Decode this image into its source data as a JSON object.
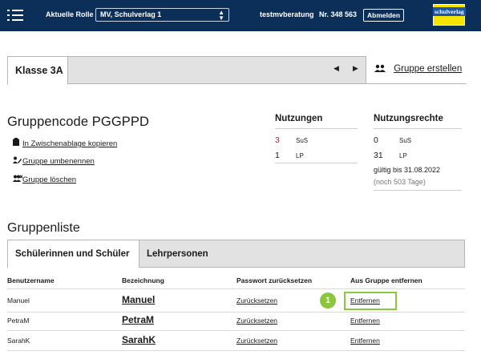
{
  "topbar": {
    "role_label": "Aktuelle Rolle",
    "role_value": "MV, Schulverlag 1",
    "user_name": "testmvberatung",
    "user_nr": "Nr. 348 563",
    "logout_label": "Abmelden",
    "logo_text": "schulverlag",
    "colors": {
      "bar": "#0c2f5a",
      "logo_bg": "#f5e400",
      "logo_text_bg": "#1b56a8"
    }
  },
  "class_tabs": {
    "active_tab": "Klasse 3A",
    "nav_prev_icon": "caret-left-icon",
    "nav_next_icon": "caret-right-icon",
    "create_group_label": "Gruppe erstellen",
    "create_group_icon": "users-icon"
  },
  "group": {
    "code_title": "Gruppencode PGGPPD",
    "actions": [
      {
        "icon": "clipboard-icon",
        "label": "In Zwischenablage kopieren"
      },
      {
        "icon": "users-edit-icon",
        "label": "Gruppe umbenennen"
      },
      {
        "icon": "users-delete-icon",
        "label": "Gruppe löschen"
      }
    ]
  },
  "usage": {
    "title": "Nutzungen",
    "rows": [
      {
        "value": "3",
        "unit": "SuS",
        "color": "#d21d1d"
      },
      {
        "value": "1",
        "unit": "LP",
        "color": "#1a1a1a"
      }
    ]
  },
  "rights": {
    "title": "Nutzungsrechte",
    "rows": [
      {
        "value": "0",
        "unit": "SuS"
      },
      {
        "value": "31",
        "unit": "LP"
      }
    ],
    "valid_until": "gültig bis 31.08.2022",
    "remaining": "(noch 503 Tage)"
  },
  "group_list": {
    "title": "Gruppenliste",
    "tabs": [
      {
        "label": "Schülerinnen und Schüler",
        "active": true
      },
      {
        "label": "Lehrpersonen",
        "active": false
      }
    ],
    "columns": [
      "Benutzername",
      "Bezeichnung",
      "Passwort zurücksetzen",
      "Aus Gruppe entfernen"
    ],
    "rows": [
      {
        "username": "Manuel",
        "name": "Manuel",
        "reset": "Zurücksetzen",
        "remove": "Entfernen"
      },
      {
        "username": "PetraM",
        "name": "PetraM",
        "reset": "Zurücksetzen",
        "remove": "Entfernen"
      },
      {
        "username": "SarahK",
        "name": "SarahK",
        "reset": "Zurücksetzen",
        "remove": "Entfernen"
      }
    ]
  },
  "annotation": {
    "step_number": "1",
    "highlight_color": "#8cc63f"
  }
}
